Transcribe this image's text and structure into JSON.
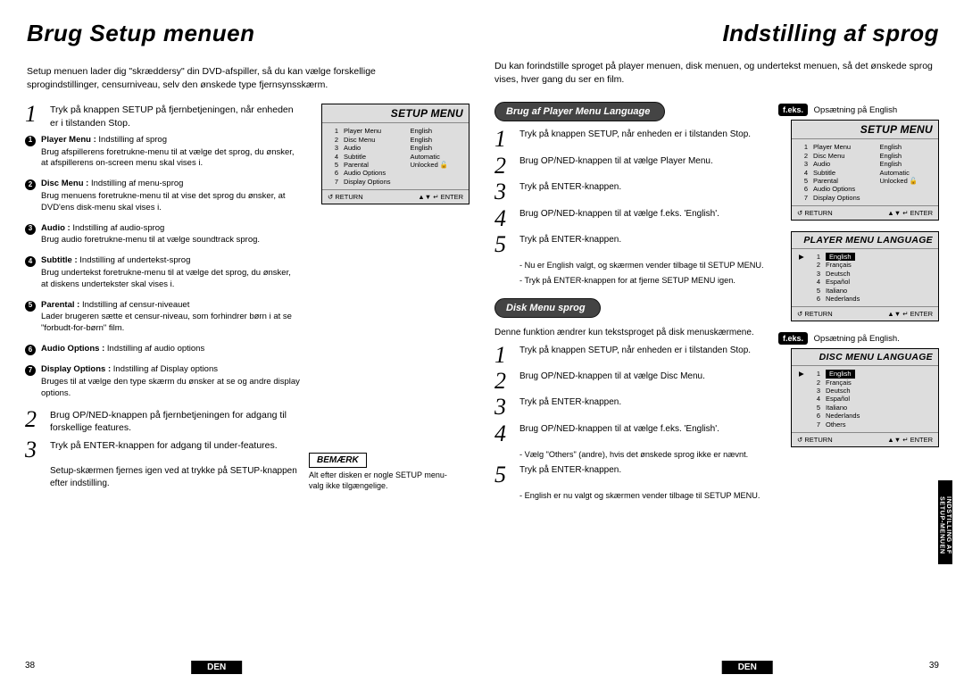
{
  "left": {
    "title": "Brug Setup menuen",
    "intro": "Setup menuen lader dig \"skræddersy\" din DVD-afspiller, så du kan vælge forskellige sprogindstillinger, censurniveau, selv den ønskede type fjernsynsskærm.",
    "steps": {
      "s1a": "Tryk på knappen SETUP på fjernbetjeningen, når enheden er i tilstanden Stop.",
      "s2a": "Brug OP/NED-knappen på fjernbetjeningen for adgang til forskellige features.",
      "s3a": "Tryk på ENTER-knappen for adgang til under-features.",
      "tail": "Setup-skærmen fjernes igen ved at trykke på SETUP-knappen efter indstilling."
    },
    "bullets": [
      {
        "n": "1",
        "t": "Player Menu :",
        "d1": "Indstilling af sprog",
        "d2": "Brug afspillerens foretrukne-menu til at vælge det sprog, du ønsker, at afspillerens on-screen menu skal vises i."
      },
      {
        "n": "2",
        "t": "Disc Menu :",
        "d1": "Indstilling af menu-sprog",
        "d2": "Brug menuens foretrukne-menu til at vise det sprog du ønsker, at DVD'ens disk-menu skal vises i."
      },
      {
        "n": "3",
        "t": "Audio :",
        "d1": "Indstilling af audio-sprog",
        "d2": "Brug audio foretrukne-menu til at vælge soundtrack sprog."
      },
      {
        "n": "4",
        "t": "Subtitle :",
        "d1": "Indstilling af undertekst-sprog",
        "d2": "Brug undertekst foretrukne-menu til at vælge det sprog, du ønsker, at diskens undertekster skal vises i."
      },
      {
        "n": "5",
        "t": "Parental :",
        "d1": "Indstilling af censur-niveauet",
        "d2": "Lader brugeren sætte et censur-niveau, som forhindrer børn i at se \"forbudt-for-børn\" film."
      },
      {
        "n": "6",
        "t": "Audio Options :",
        "d1": "Indstilling af audio options",
        "d2": ""
      },
      {
        "n": "7",
        "t": "Display Options :",
        "d1": "Indstilling af Display options",
        "d2": "Bruges til at vælge den type skærm du ønsker at se og andre display options."
      }
    ],
    "bemark": {
      "label": "BEMÆRK",
      "note": "Alt efter disken er nogle SETUP menu-valg ikke tilgængelige."
    },
    "page": "38"
  },
  "right": {
    "title": "Indstilling af sprog",
    "intro": "Du kan forindstille sproget på player menuen, disk menuen, og undertekst menuen, så det ønskede sprog vises, hver gang du ser en film.",
    "section1": {
      "pill": "Brug af Player Menu Language",
      "feks": "f.eks.",
      "fekstxt": "Opsætning på English",
      "s1": "Tryk på knappen SETUP, når enheden er i tilstanden Stop.",
      "s2": "Brug OP/NED-knappen til at vælge Player Menu.",
      "s3": "Tryk på ENTER-knappen.",
      "s4": "Brug OP/NED-knappen til at vælge f.eks. 'English'.",
      "s5": "Tryk på ENTER-knappen.",
      "n1": "Nu er English valgt, og skærmen vender tilbage til SETUP MENU.",
      "n2": "Tryk på ENTER-knappen for at fjerne SETUP MENU igen."
    },
    "section2": {
      "pill": "Disk Menu sprog",
      "feks": "f.eks.",
      "fekstxt": "Opsætning på English.",
      "lead": "Denne funktion ændrer kun tekstsproget på disk menuskærmene.",
      "s1": "Tryk på knappen SETUP, når enheden er i tilstanden Stop.",
      "s2": "Brug OP/NED-knappen til at vælge Disc Menu.",
      "s3": "Tryk på ENTER-knappen.",
      "s4": "Brug OP/NED-knappen til at vælge f.eks. 'English'.",
      "n1": "Vælg \"Others\" (andre), hvis det ønskede sprog ikke er nævnt.",
      "s5": "Tryk på ENTER-knappen.",
      "n2": "English er nu valgt og skærmen vender tilbage til SETUP MENU."
    },
    "menus": {
      "setup": {
        "title": "SETUP MENU",
        "rows": [
          [
            "1",
            "Player Menu",
            "English"
          ],
          [
            "2",
            "Disc Menu",
            "English"
          ],
          [
            "3",
            "Audio",
            "English"
          ],
          [
            "4",
            "Subtitle",
            "Automatic"
          ],
          [
            "5",
            "Parental",
            "Unlocked 🔓"
          ],
          [
            "6",
            "Audio Options",
            ""
          ],
          [
            "7",
            "Display Options",
            ""
          ]
        ],
        "retL": "↺ RETURN",
        "retR": "▲▼ ↵ ENTER"
      },
      "pml": {
        "title": "PLAYER MENU LANGUAGE",
        "rows": [
          [
            "1",
            "English",
            true
          ],
          [
            "2",
            "Français",
            false
          ],
          [
            "3",
            "Deutsch",
            false
          ],
          [
            "4",
            "Español",
            false
          ],
          [
            "5",
            "Italiano",
            false
          ],
          [
            "6",
            "Nederlands",
            false
          ]
        ],
        "retL": "↺ RETURN",
        "retR": "▲▼ ↵ ENTER"
      },
      "dml": {
        "title": "DISC MENU LANGUAGE",
        "rows": [
          [
            "1",
            "English",
            true
          ],
          [
            "2",
            "Français",
            false
          ],
          [
            "3",
            "Deutsch",
            false
          ],
          [
            "4",
            "Español",
            false
          ],
          [
            "5",
            "Italiano",
            false
          ],
          [
            "6",
            "Nederlands",
            false
          ],
          [
            "7",
            "Others",
            false
          ]
        ],
        "retL": "↺ RETURN",
        "retR": "▲▼ ↵ ENTER"
      }
    },
    "tab": "INDSTILLING AF\nSETUP-MENUEN",
    "page": "39",
    "den": "DEN"
  }
}
